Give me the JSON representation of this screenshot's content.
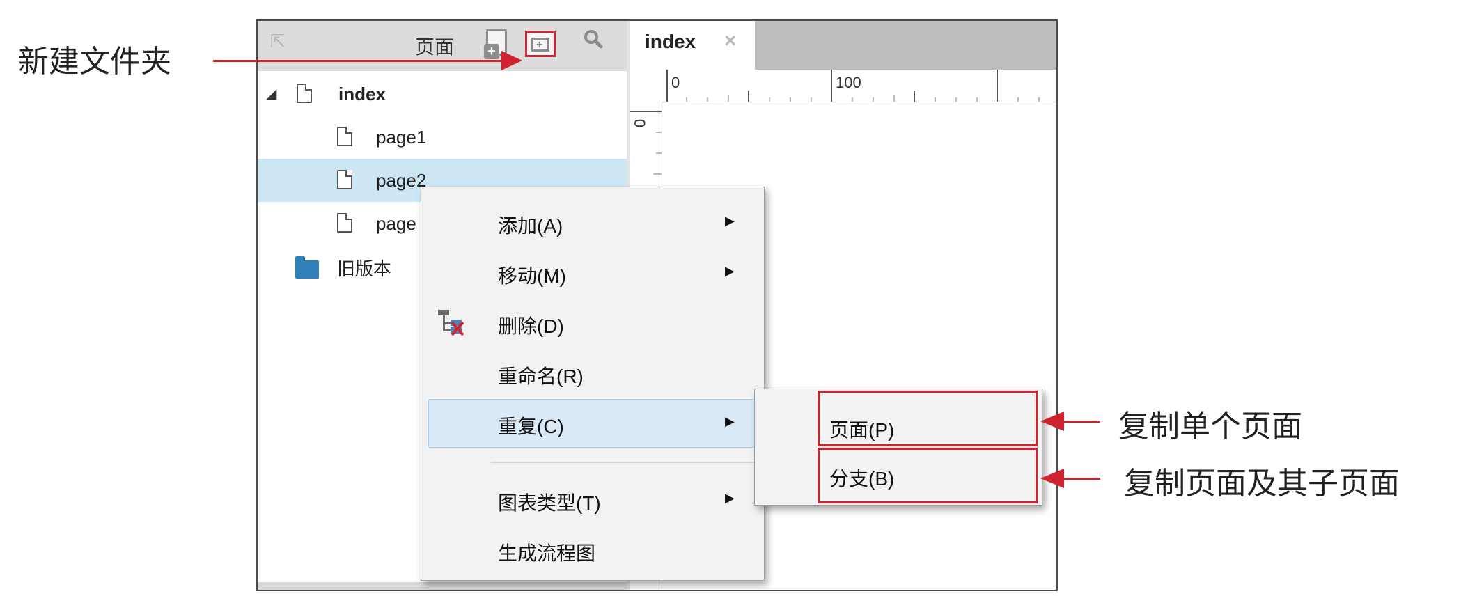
{
  "pages_panel": {
    "title": "页面",
    "tree": [
      {
        "label": "index"
      },
      {
        "label": "page1"
      },
      {
        "label": "page2"
      },
      {
        "label": "page"
      },
      {
        "label": "旧版本"
      }
    ]
  },
  "canvas": {
    "tab_label": "index",
    "tab_close": "×",
    "ruler_h_labels": [
      "0",
      "100"
    ],
    "ruler_v_labels": [
      "0"
    ]
  },
  "context_menu": {
    "items": [
      {
        "label": "添加(A)",
        "arrow": "▶"
      },
      {
        "label": "移动(M)",
        "arrow": "▶"
      },
      {
        "label": "删除(D)"
      },
      {
        "label": "重命名(R)"
      },
      {
        "label": "重复(C)",
        "arrow": "▶"
      },
      {
        "label": "图表类型(T)",
        "arrow": "▶"
      },
      {
        "label": "生成流程图"
      }
    ]
  },
  "submenu": {
    "items": [
      {
        "label": "页面(P)"
      },
      {
        "label": "分支(B)"
      }
    ]
  },
  "annotations": {
    "new_folder": "新建文件夹",
    "copy_single": "复制单个页面",
    "copy_with_children": "复制页面及其子页面"
  },
  "colors": {
    "highlight_red": "#cf2330",
    "selection_blue": "#cde6f3",
    "folder_blue": "#2f7fb8"
  }
}
